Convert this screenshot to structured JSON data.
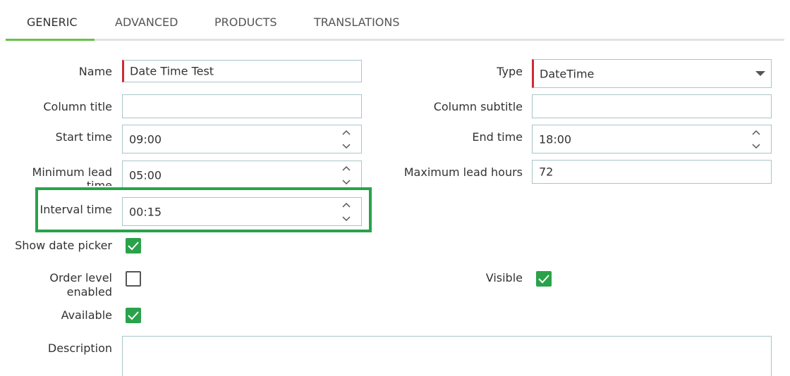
{
  "tabs": [
    {
      "label": "GENERIC",
      "active": true
    },
    {
      "label": "ADVANCED",
      "active": false
    },
    {
      "label": "PRODUCTS",
      "active": false
    },
    {
      "label": "TRANSLATIONS",
      "active": false
    }
  ],
  "form": {
    "name": {
      "label": "Name",
      "value": "Date Time Test"
    },
    "type": {
      "label": "Type",
      "value": "DateTime"
    },
    "column_title": {
      "label": "Column title",
      "value": ""
    },
    "column_subtitle": {
      "label": "Column subtitle",
      "value": ""
    },
    "start_time": {
      "label": "Start time",
      "value": "09:00"
    },
    "end_time": {
      "label": "End time",
      "value": "18:00"
    },
    "min_lead_time": {
      "label_line1": "Minimum lead",
      "label_line2": "time",
      "value": "05:00"
    },
    "max_lead_hours": {
      "label": "Maximum lead hours",
      "value": "72"
    },
    "interval_time": {
      "label": "Interval time",
      "value": "00:15"
    },
    "show_date_picker": {
      "label": "Show date picker",
      "checked": true
    },
    "order_level_enabled": {
      "label_line1": "Order level",
      "label_line2": "enabled",
      "checked": false
    },
    "visible": {
      "label": "Visible",
      "checked": true
    },
    "available": {
      "label": "Available",
      "checked": true
    },
    "description": {
      "label": "Description",
      "value": ""
    }
  },
  "colors": {
    "accent_green": "#2aa24a",
    "tab_underline": "#6ac04a",
    "required_marker": "#cc2b36",
    "field_border": "#a9c4c8"
  }
}
